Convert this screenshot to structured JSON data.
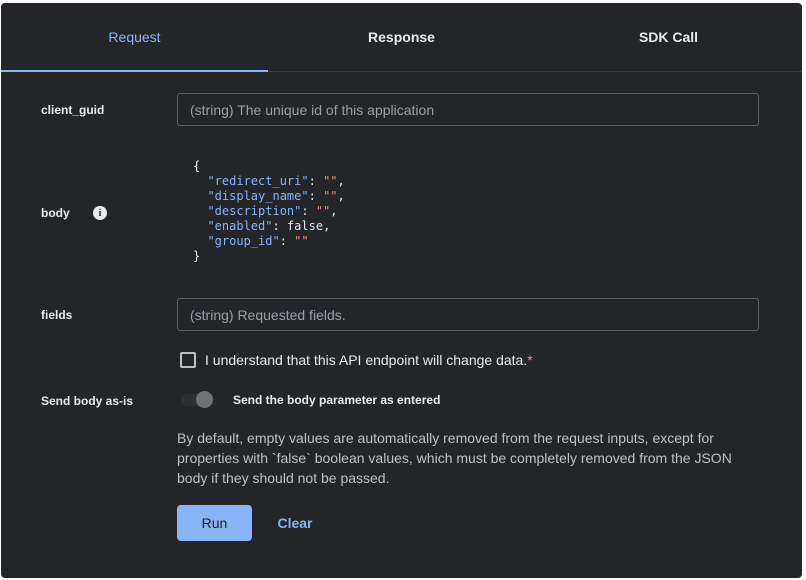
{
  "tabs": [
    {
      "label": "Request",
      "active": true
    },
    {
      "label": "Response",
      "active": false
    },
    {
      "label": "SDK Call",
      "active": false
    }
  ],
  "fields": {
    "client_guid": {
      "label": "client_guid",
      "placeholder": "(string) The unique id of this application",
      "value": ""
    },
    "body": {
      "label": "body",
      "info_icon": "info-icon",
      "json": {
        "open": "{",
        "close": "}",
        "lines": [
          {
            "key": "\"redirect_uri\"",
            "value": "\"\"",
            "trail": ","
          },
          {
            "key": "\"display_name\"",
            "value": "\"\"",
            "trail": ","
          },
          {
            "key": "\"description\"",
            "value": "\"\"",
            "trail": ","
          },
          {
            "key": "\"enabled\"",
            "value": "false",
            "trail": ","
          },
          {
            "key": "\"group_id\"",
            "value": "\"\"",
            "trail": ""
          }
        ]
      }
    },
    "fields": {
      "label": "fields",
      "placeholder": "(string) Requested fields.",
      "value": ""
    }
  },
  "confirm": {
    "label": "I understand that this API endpoint will change data.",
    "required_mark": "*",
    "checked": false
  },
  "send_as_is": {
    "label": "Send body as-is",
    "toggle_label": "Send the body parameter as entered",
    "on": false
  },
  "note": "By default, empty values are automatically removed from the request inputs, except for properties with `false` boolean values, which must be completely removed from the JSON body if they should not be passed.",
  "actions": {
    "run": "Run",
    "clear": "Clear"
  },
  "colors": {
    "accent": "#8ab4f8",
    "background": "#232529",
    "required": "#f28b82"
  }
}
